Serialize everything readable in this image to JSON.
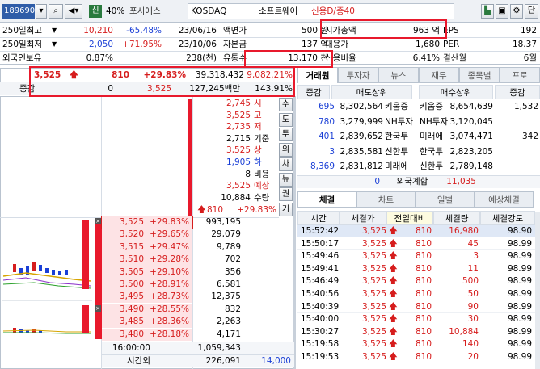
{
  "toolbar": {
    "code": "189690",
    "badge_new": "신",
    "pct": "40%",
    "stock_name": "포시에스",
    "market": "KOSDAQ",
    "sector": "소프트웨어",
    "credit": "신용D/증40"
  },
  "info_left": [
    {
      "label": "250일최고",
      "v1": "10,210",
      "v2": "-65.48%",
      "date": "23/06/16"
    },
    {
      "label": "250일최저",
      "v1": "2,050",
      "v2": "+71.95%",
      "date": "23/10/06"
    },
    {
      "label": "외국인보유",
      "v1": "0.87%",
      "v2": "",
      "date": "238(천)"
    }
  ],
  "info_mid": [
    {
      "label": "액면가",
      "value": "500 원"
    },
    {
      "label": "자본금",
      "value": "137 억"
    },
    {
      "label": "유통수",
      "value": "13,170 천"
    }
  ],
  "info_right": [
    {
      "label": "시가총액",
      "value": "963 억",
      "label2": "EPS",
      "value2": "192"
    },
    {
      "label": "대용가",
      "value": "1,680",
      "label2": "PER",
      "value2": "18.37"
    },
    {
      "label": "신용비율",
      "value": "6.41%",
      "label2": "결산월",
      "value2": "6월"
    }
  ],
  "price_bar": {
    "price": "3,525",
    "change": "810",
    "pct": "+29.83%",
    "volume": "39,318,432",
    "vol_pct": "9,082.21%"
  },
  "price_bar2": {
    "label": "증감",
    "v1": "0",
    "v2": "3,525",
    "v3": "127,245백만",
    "v4": "143.91%"
  },
  "side_letters": [
    "수",
    "도",
    "투",
    "외",
    "차",
    "뉴",
    "권",
    "기"
  ],
  "summary": [
    {
      "v": "2,745",
      "l": "시",
      "cls": "red"
    },
    {
      "v": "3,525",
      "l": "고",
      "cls": "red"
    },
    {
      "v": "2,735",
      "l": "저",
      "cls": "red"
    },
    {
      "v": "2,715",
      "l": "기준",
      "cls": ""
    },
    {
      "v": "3,525",
      "l": "상",
      "cls": "red"
    },
    {
      "v": "1,905",
      "l": "하",
      "cls": "blue"
    },
    {
      "v": "8",
      "l": "비용",
      "cls": ""
    },
    {
      "v": "3,525",
      "l": "예상",
      "cls": "red"
    },
    {
      "v": "10,884",
      "l": "수량",
      "cls": ""
    }
  ],
  "expected": {
    "change": "810",
    "pct": "+29.83%"
  },
  "orderbook": [
    {
      "price": "3,525",
      "pct": "+29.83%",
      "qty": "993,195",
      "cur": true
    },
    {
      "price": "3,520",
      "pct": "+29.65%",
      "qty": "29,079"
    },
    {
      "price": "3,515",
      "pct": "+29.47%",
      "qty": "9,789"
    },
    {
      "price": "3,510",
      "pct": "+29.28%",
      "qty": "702"
    },
    {
      "price": "3,505",
      "pct": "+29.10%",
      "qty": "356"
    },
    {
      "price": "3,500",
      "pct": "+28.91%",
      "qty": "6,581"
    },
    {
      "price": "3,495",
      "pct": "+28.73%",
      "qty": "12,375"
    },
    {
      "price": "3,490",
      "pct": "+28.55%",
      "qty": "832"
    },
    {
      "price": "3,485",
      "pct": "+28.36%",
      "qty": "2,263"
    },
    {
      "price": "3,480",
      "pct": "+28.18%",
      "qty": "4,171"
    }
  ],
  "ob_footer": [
    {
      "label": "16:00:00",
      "v1": "1,059,343",
      "v2": ""
    },
    {
      "label": "시간외",
      "v1": "226,091",
      "v2": "14,000"
    }
  ],
  "top_tabs": [
    "거래원",
    "투자자",
    "뉴스",
    "재무",
    "종목별",
    "프로"
  ],
  "broker_head": [
    "증감",
    "매도상위",
    "매수상위",
    "증감"
  ],
  "brokers": [
    {
      "d1": "695",
      "s": "8,302,564",
      "sn": "키움증",
      "bn": "키움증",
      "b": "8,654,639",
      "d2": "1,532"
    },
    {
      "d1": "780",
      "s": "3,279,999",
      "sn": "NH투자",
      "bn": "NH투자",
      "b": "3,120,045",
      "d2": ""
    },
    {
      "d1": "401",
      "s": "2,839,652",
      "sn": "한국투",
      "bn": "미래에",
      "b": "3,074,471",
      "d2": "342"
    },
    {
      "d1": "3",
      "s": "2,835,581",
      "sn": "신한투",
      "bn": "한국투",
      "b": "2,823,205",
      "d2": ""
    },
    {
      "d1": "8,369",
      "s": "2,831,812",
      "sn": "미래에",
      "bn": "신한투",
      "b": "2,789,148",
      "d2": ""
    }
  ],
  "foreign": {
    "d1": "0",
    "label": "외국계합",
    "b": "11,035"
  },
  "trade_tabs": [
    "체결",
    "차트",
    "일별",
    "예상체결"
  ],
  "trade_head": [
    "시간",
    "체결가",
    "전일대비",
    "체결량",
    "체결강도"
  ],
  "trades": [
    {
      "t": "15:52:42",
      "p": "3,525",
      "c": "810",
      "q": "16,980",
      "s": "98.90"
    },
    {
      "t": "15:50:17",
      "p": "3,525",
      "c": "810",
      "q": "45",
      "s": "98.99"
    },
    {
      "t": "15:49:46",
      "p": "3,525",
      "c": "810",
      "q": "3",
      "s": "98.99"
    },
    {
      "t": "15:49:41",
      "p": "3,525",
      "c": "810",
      "q": "11",
      "s": "98.99"
    },
    {
      "t": "15:46:49",
      "p": "3,525",
      "c": "810",
      "q": "500",
      "s": "98.99"
    },
    {
      "t": "15:40:56",
      "p": "3,525",
      "c": "810",
      "q": "50",
      "s": "98.99"
    },
    {
      "t": "15:40:39",
      "p": "3,525",
      "c": "810",
      "q": "90",
      "s": "98.99"
    },
    {
      "t": "15:40:00",
      "p": "3,525",
      "c": "810",
      "q": "30",
      "s": "98.99"
    },
    {
      "t": "15:30:27",
      "p": "3,525",
      "c": "810",
      "q": "10,884",
      "s": "98.99"
    },
    {
      "t": "15:19:58",
      "p": "3,525",
      "c": "810",
      "q": "140",
      "s": "98.99"
    },
    {
      "t": "15:19:53",
      "p": "3,525",
      "c": "810",
      "q": "20",
      "s": "98.99"
    }
  ],
  "colors": {
    "up": "#d61d1d",
    "down": "#1a3fd6",
    "highlight": "#e8192c"
  }
}
